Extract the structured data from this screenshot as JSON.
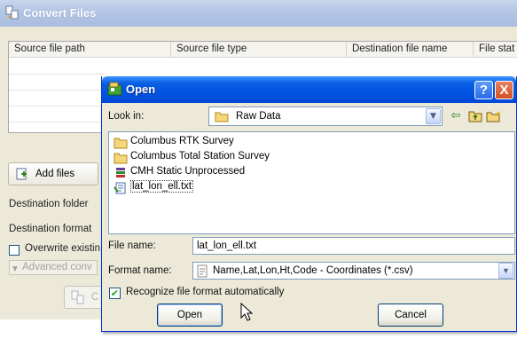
{
  "background_window": {
    "title": "Convert Files",
    "columns": [
      "Source file path",
      "Source file type",
      "Destination file name",
      "File stat"
    ],
    "add_files_label": "Add files",
    "destination_folder_label": "Destination folder",
    "destination_format_label": "Destination format",
    "overwrite_label": "Overwrite existin",
    "advanced_label": "Advanced conv",
    "convert_label": "C"
  },
  "dialog": {
    "title": "Open",
    "help_label": "?",
    "close_label": "X",
    "look_in_label": "Look in:",
    "look_in_value": "Raw Data",
    "files": [
      {
        "name": "Columbus RTK Survey",
        "icon": "folder-icon"
      },
      {
        "name": "Columbus Total Station Survey",
        "icon": "folder-icon"
      },
      {
        "name": "CMH Static Unprocessed",
        "icon": "database-icon"
      },
      {
        "name": "lat_lon_ell.txt",
        "icon": "text-file-icon"
      }
    ],
    "file_name_label": "File name:",
    "file_name_value": "lat_lon_ell.txt",
    "format_name_label": "Format name:",
    "format_name_value": "Name,Lat,Lon,Ht,Code - Coordinates (*.csv)",
    "recognize_label": "Recognize file format automatically",
    "recognize_checked": "✔",
    "open_button": "Open",
    "cancel_button": "Cancel"
  },
  "colors": {
    "dialog_titlebar": "#0054e3",
    "background_titlebar": "#b3c5e4",
    "window_face": "#ece9d8"
  }
}
